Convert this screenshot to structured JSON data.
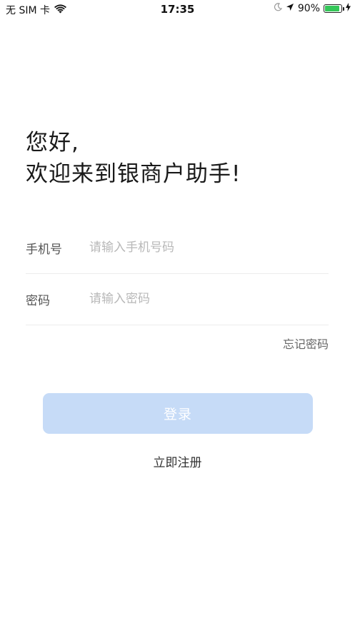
{
  "status_bar": {
    "carrier": "无 SIM 卡",
    "time": "17:35",
    "battery_percent": "90%",
    "battery_level": 0.9,
    "battery_color": "#34c759"
  },
  "greeting": {
    "line1": "您好,",
    "line2": "欢迎来到银商户助手!"
  },
  "form": {
    "phone": {
      "label": "手机号",
      "placeholder": "请输入手机号码",
      "value": ""
    },
    "password": {
      "label": "密码",
      "placeholder": "请输入密码",
      "value": ""
    },
    "forgot_label": "忘记密码"
  },
  "actions": {
    "login_label": "登录",
    "register_label": "立即注册"
  },
  "colors": {
    "login_button_bg": "#c6dbf7",
    "divider": "#ececec"
  }
}
